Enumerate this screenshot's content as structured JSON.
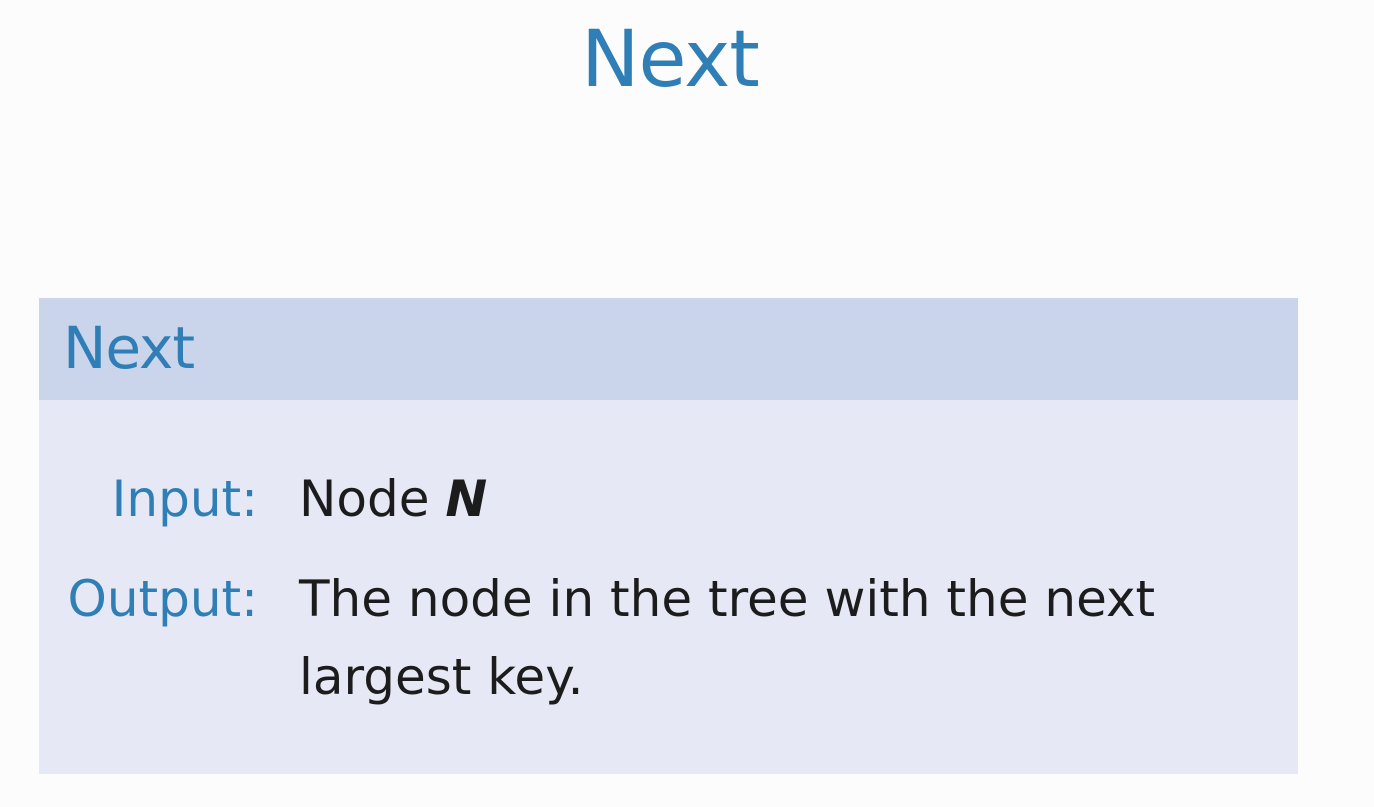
{
  "slide": {
    "title": "Next"
  },
  "block": {
    "title": "Next",
    "input": {
      "label": "Input:",
      "value_text": "Node",
      "value_math": "N"
    },
    "output": {
      "label": "Output:",
      "line1": "The node in the tree with the next",
      "line2": "largest key."
    }
  },
  "colors": {
    "accent": "#2f7fb6",
    "block_header_bg": "#cad4ea",
    "block_body_bg": "#e6e9f5",
    "text": "#1c1c1c",
    "page_bg": "#fcfcfc"
  }
}
